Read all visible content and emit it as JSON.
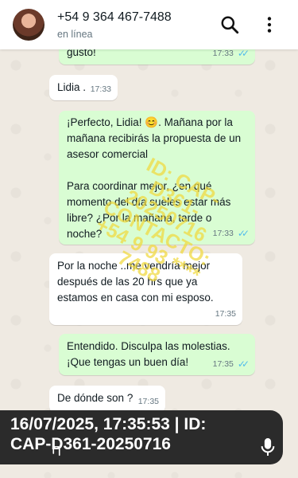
{
  "header": {
    "contact_name": "+54 9 364 467-7488",
    "status": "en línea",
    "search_icon": "search-icon",
    "menu_icon": "more-vertical-icon"
  },
  "messages": [
    {
      "direction": "outgoing",
      "text": "gusto!",
      "time": "17:33",
      "read": true
    },
    {
      "direction": "incoming",
      "text": "Lidia .",
      "time": "17:33"
    },
    {
      "direction": "outgoing",
      "text": "¡Perfecto, Lidia! 😊. Mañana por la mañana recibirás la propuesta de un asesor comercial\n\nPara coordinar mejor, ¿en qué momento del día sueles estar más libre? ¿Por la mañana, tarde o noche?",
      "time": "17:33",
      "read": true
    },
    {
      "direction": "incoming",
      "text": "Por la noche ..me vendría mejor después de las 20 hrs que ya estamos en casa con mi esposo.",
      "time": "17:35"
    },
    {
      "direction": "outgoing",
      "text": "Entendido. Disculpa las molestias. ¡Que tengas un buen día!",
      "time": "17:35",
      "read": true
    },
    {
      "direction": "incoming",
      "text": "De dónde son ?",
      "time": "17:35"
    }
  ],
  "watermark": {
    "line1": "ID: CAP-",
    "line2": "D361-",
    "line3": "20250716",
    "line4": "CONTACTO:",
    "line5": "+54 9 93 ****",
    "line6": "7488"
  },
  "footer_stamp": {
    "line1": "16/07/2025, 17:35:53 | ID:",
    "line2": "CAP-D361-20250716"
  },
  "colors": {
    "outgoing_bubble": "#d9fdd3",
    "incoming_bubble": "#ffffff",
    "read_ticks": "#53bdeb",
    "chat_background": "#efeae2"
  }
}
